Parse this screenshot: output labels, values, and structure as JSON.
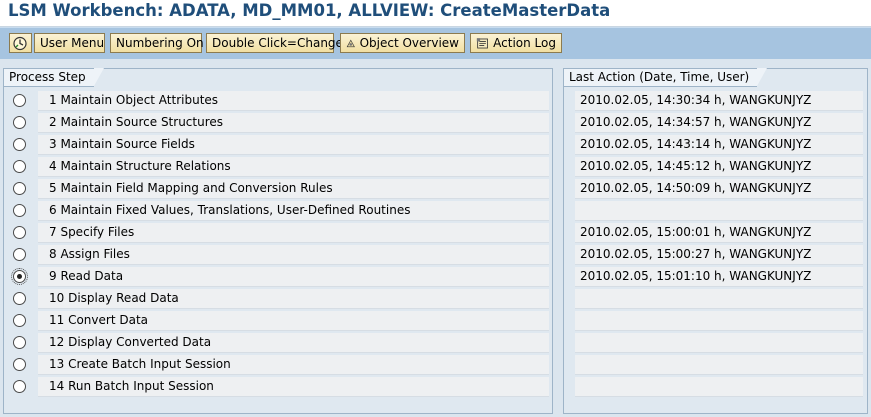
{
  "window": {
    "title": "LSM Workbench: ADATA, MD_MM01, ALLVIEW: CreateMasterData"
  },
  "toolbar": {
    "buttons": [
      {
        "label": "",
        "icon": "execute-clock-icon"
      },
      {
        "label": "User Menu"
      },
      {
        "label": "Numbering On"
      },
      {
        "label": "Double Click=Change"
      },
      {
        "label": "Object Overview",
        "icon": "object-overview-icon"
      },
      {
        "label": "Action Log",
        "icon": "action-log-icon"
      }
    ]
  },
  "process_panel": {
    "header": "Process Step",
    "selected_index": 8,
    "steps": [
      {
        "label": "1 Maintain Object Attributes",
        "action": "2010.02.05, 14:30:34 h, WANGKUNJYZ"
      },
      {
        "label": "2 Maintain Source Structures",
        "action": "2010.02.05, 14:34:57 h, WANGKUNJYZ"
      },
      {
        "label": "3 Maintain Source Fields",
        "action": "2010.02.05, 14:43:14 h, WANGKUNJYZ"
      },
      {
        "label": "4 Maintain Structure Relations",
        "action": "2010.02.05, 14:45:12 h, WANGKUNJYZ"
      },
      {
        "label": "5 Maintain Field Mapping and Conversion Rules",
        "action": "2010.02.05, 14:50:09 h, WANGKUNJYZ"
      },
      {
        "label": "6 Maintain Fixed Values, Translations, User-Defined Routines",
        "action": ""
      },
      {
        "label": "7 Specify Files",
        "action": "2010.02.05, 15:00:01 h, WANGKUNJYZ"
      },
      {
        "label": "8 Assign Files",
        "action": "2010.02.05, 15:00:27 h, WANGKUNJYZ"
      },
      {
        "label": "9 Read Data",
        "action": "2010.02.05, 15:01:10 h, WANGKUNJYZ"
      },
      {
        "label": "10 Display Read Data",
        "action": ""
      },
      {
        "label": "11 Convert Data",
        "action": ""
      },
      {
        "label": "12 Display Converted Data",
        "action": ""
      },
      {
        "label": "13 Create Batch Input Session",
        "action": ""
      },
      {
        "label": "14 Run Batch Input Session",
        "action": ""
      }
    ]
  },
  "action_panel": {
    "header": "Last Action (Date, Time, User)"
  },
  "colors": {
    "title": "#1f4e7a",
    "toolbar_bg": "#a6c4e0",
    "button_bg": "#f1dfa2"
  }
}
